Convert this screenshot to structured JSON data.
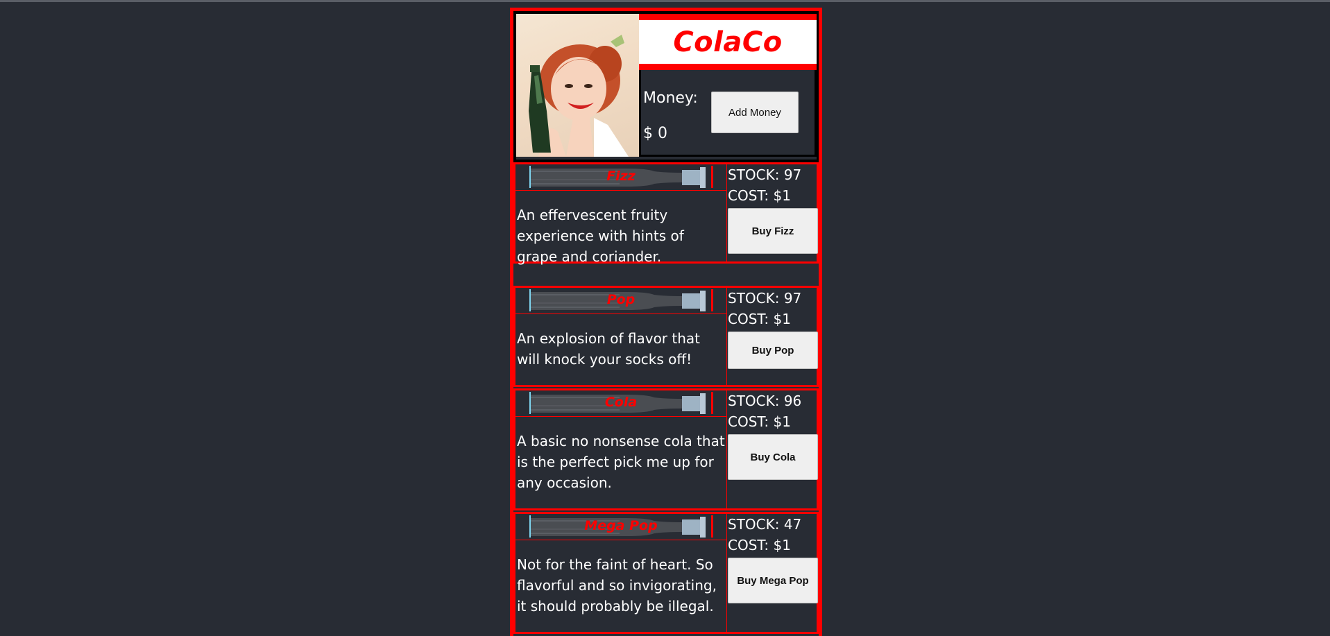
{
  "brand": {
    "title": "ColaCo",
    "accent_color": "#ff0000"
  },
  "wallet": {
    "money_label": "Money:",
    "money_value": "$ 0",
    "add_money_label": "Add Money"
  },
  "sodas": [
    {
      "name": "Fizz",
      "description": "An effervescent fruity experience with hints of grape and coriander.",
      "stock": "STOCK: 97",
      "cost": "COST: $1",
      "buy_label": "Buy Fizz"
    },
    {
      "name": "Pop",
      "description": "An explosion of flavor that will knock your socks off!",
      "stock": "STOCK: 97",
      "cost": "COST: $1",
      "buy_label": "Buy Pop"
    },
    {
      "name": "Cola",
      "description": "A basic no nonsense cola that is the perfect pick me up for any occasion.",
      "stock": "STOCK: 96",
      "cost": "COST: $1",
      "buy_label": "Buy Cola"
    },
    {
      "name": "Mega Pop",
      "description": "Not for the faint of heart. So flavorful and so invigorating, it should probably be illegal.",
      "stock": "STOCK: 47",
      "cost": "COST: $1",
      "buy_label": "Buy Mega Pop"
    }
  ]
}
